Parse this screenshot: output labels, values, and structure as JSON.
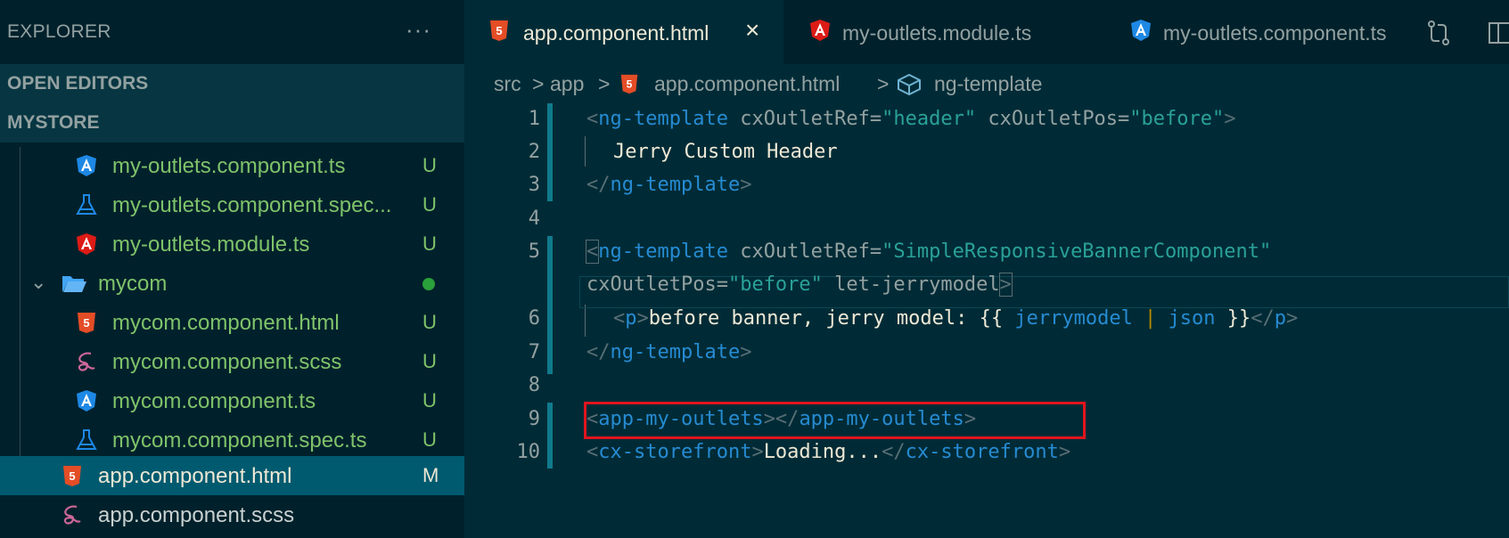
{
  "sidebar": {
    "title": "EXPLORER",
    "more": "···",
    "open_editors": "OPEN EDITORS",
    "project": "MYSTORE",
    "files": [
      {
        "name": "my-outlets.component.ts",
        "icon": "angular-blue-icon",
        "status": "U"
      },
      {
        "name": "my-outlets.component.spec...",
        "icon": "flask-icon",
        "status": "U"
      },
      {
        "name": "my-outlets.module.ts",
        "icon": "angular-red-icon",
        "status": "U"
      },
      {
        "name": "mycom",
        "icon": "folder-open-icon",
        "status": "●"
      },
      {
        "name": "mycom.component.html",
        "icon": "html5-icon",
        "status": "U"
      },
      {
        "name": "mycom.component.scss",
        "icon": "sass-icon",
        "status": "U"
      },
      {
        "name": "mycom.component.ts",
        "icon": "angular-blue-icon",
        "status": "U"
      },
      {
        "name": "mycom.component.spec.ts",
        "icon": "flask-icon",
        "status": "U"
      },
      {
        "name": "app.component.html",
        "icon": "html5-icon",
        "status": "M"
      },
      {
        "name": "app.component.scss",
        "icon": "sass-icon",
        "status": ""
      }
    ]
  },
  "tabs": [
    {
      "label": "app.component.html",
      "icon": "html5-icon",
      "active": true,
      "close": "×"
    },
    {
      "label": "my-outlets.module.ts",
      "icon": "angular-red-icon",
      "active": false
    },
    {
      "label": "my-outlets.component.ts",
      "icon": "angular-blue-icon",
      "active": false
    }
  ],
  "breadcrumb": {
    "parts": [
      "src",
      "app",
      "app.component.html",
      "ng-template"
    ],
    "sep": ">"
  },
  "editor": {
    "line_numbers": [
      "1",
      "2",
      "3",
      "4",
      "5",
      "6",
      "7",
      "8",
      "9",
      "10"
    ],
    "lines": {
      "l1_a": "<",
      "l1_tag": "ng-template",
      "l1_attr1": " cxOutletRef=",
      "l1_val1": "\"header\"",
      "l1_attr2": " cxOutletPos=",
      "l1_val2": "\"before\"",
      "l1_close": ">",
      "l2_text": "Jerry Custom Header",
      "l3_a": "</",
      "l3_tag": "ng-template",
      "l3_close": ">",
      "l5_a": "<",
      "l5_tag": "ng-template",
      "l5_attr1": " cxOutletRef=",
      "l5_val1": "\"SimpleResponsiveBannerComponent\"",
      "l5b_attr": "cxOutletPos=",
      "l5b_val": "\"before\"",
      "l5b_attr2": " let-jerrymodel",
      "l5b_close": ">",
      "l6_a": "<",
      "l6_tag": "p",
      "l6_close": ">",
      "l6_text": "before banner, jerry model: {{ ",
      "l6_var": "jerrymodel",
      "l6_pipe": " | ",
      "l6_json": "json",
      "l6_end": " }}",
      "l6_ca": "</",
      "l6_ctag": "p",
      "l6_cclose": ">",
      "l7_a": "</",
      "l7_tag": "ng-template",
      "l7_close": ">",
      "l9_a": "<",
      "l9_tag": "app-my-outlets",
      "l9_mid": "></",
      "l9_tag2": "app-my-outlets",
      "l9_close": ">",
      "l10_a": "<",
      "l10_tag": "cx-storefront",
      "l10_mid": ">",
      "l10_text": "Loading...",
      "l10_ca": "</",
      "l10_tag2": "cx-storefront",
      "l10_close": ">"
    }
  },
  "colors": {
    "html": "#e44d26",
    "angular_red": "#dd1b16",
    "angular_blue": "#1e88e5",
    "sass": "#cd6799",
    "highlight": "#e0151e"
  }
}
